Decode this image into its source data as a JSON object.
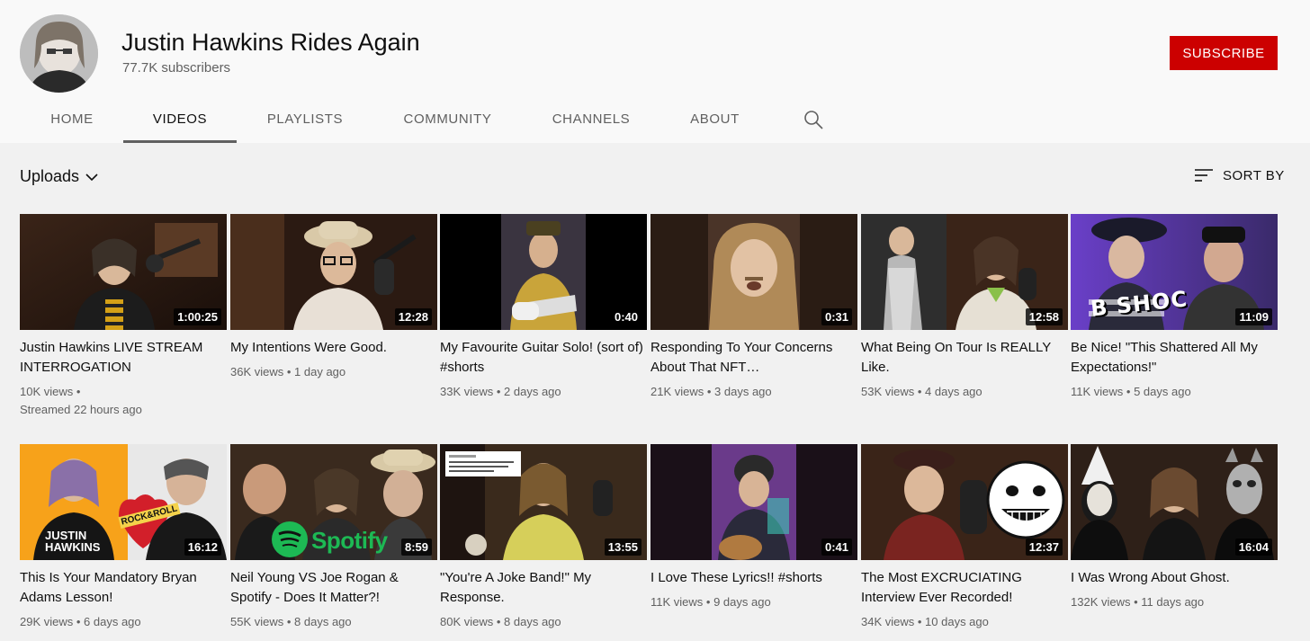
{
  "channel": {
    "name": "Justin Hawkins Rides Again",
    "subscribers": "77.7K subscribers",
    "subscribe_label": "SUBSCRIBE"
  },
  "tabs": [
    {
      "label": "HOME",
      "active": false
    },
    {
      "label": "VIDEOS",
      "active": true
    },
    {
      "label": "PLAYLISTS",
      "active": false
    },
    {
      "label": "COMMUNITY",
      "active": false
    },
    {
      "label": "CHANNELS",
      "active": false
    },
    {
      "label": "ABOUT",
      "active": false
    }
  ],
  "search_icon": "search-icon",
  "uploads_label": "Uploads",
  "sort_label": "SORT BY",
  "videos": [
    {
      "title": "Justin Hawkins LIVE STREAM INTERROGATION",
      "duration": "1:00:25",
      "views": "10K views",
      "age": "Streamed 22 hours ago"
    },
    {
      "title": "My Intentions Were Good.",
      "duration": "12:28",
      "views": "36K views",
      "age": "1 day ago"
    },
    {
      "title": "My Favourite Guitar Solo! (sort of) #shorts",
      "duration": "0:40",
      "views": "33K views",
      "age": "2 days ago"
    },
    {
      "title": "Responding To Your Concerns About That NFT…",
      "duration": "0:31",
      "views": "21K views",
      "age": "3 days ago"
    },
    {
      "title": "What Being On Tour Is REALLY Like.",
      "duration": "12:58",
      "views": "53K views",
      "age": "4 days ago"
    },
    {
      "title": "Be Nice! \"This Shattered All My Expectations!\"",
      "duration": "11:09",
      "views": "11K views",
      "age": "5 days ago"
    },
    {
      "title": "This Is Your Mandatory Bryan Adams Lesson!",
      "duration": "16:12",
      "views": "29K views",
      "age": "6 days ago"
    },
    {
      "title": "Neil Young VS Joe Rogan & Spotify - Does It Matter?!",
      "duration": "8:59",
      "views": "55K views",
      "age": "8 days ago"
    },
    {
      "title": "\"You're A Joke Band!\" My Response.",
      "duration": "13:55",
      "views": "80K views",
      "age": "8 days ago"
    },
    {
      "title": "I Love These Lyrics!! #shorts",
      "duration": "0:41",
      "views": "11K views",
      "age": "9 days ago"
    },
    {
      "title": "The Most EXCRUCIATING Interview Ever Recorded!",
      "duration": "12:37",
      "views": "34K views",
      "age": "10 days ago"
    },
    {
      "title": "I Was Wrong About Ghost.",
      "duration": "16:04",
      "views": "132K views",
      "age": "11 days ago"
    }
  ],
  "thumb_overlays": {
    "thumb6_text": "B SHOC",
    "thumb7_text1": "ROCK&ROLL",
    "thumb7_text2": "JUSTIN HAWKINS",
    "thumb8_text": "Spotify"
  },
  "colors": {
    "subscribe": "#cc0000",
    "page_bg": "#f1f1f1",
    "header_bg": "#f9f9f9"
  }
}
